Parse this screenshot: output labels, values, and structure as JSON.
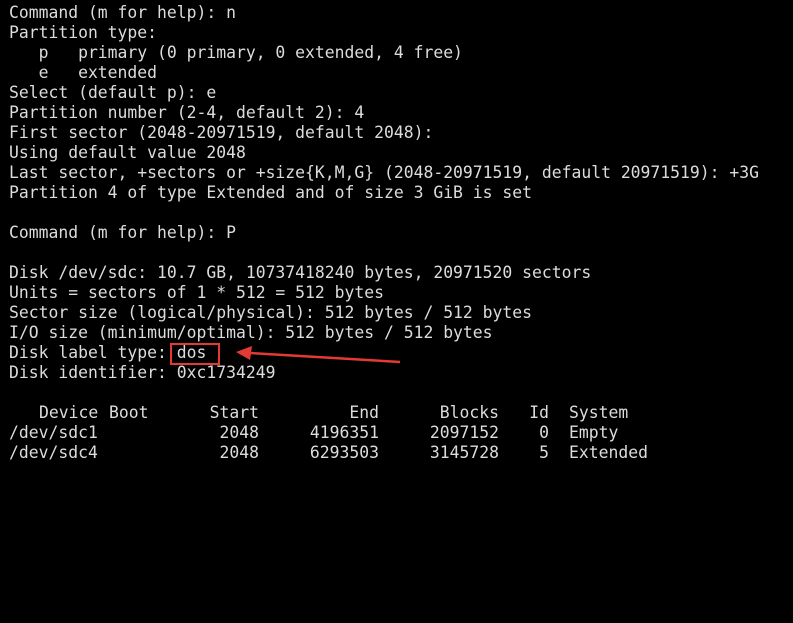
{
  "terminal": {
    "lines": [
      "Command (m for help): n",
      "Partition type:",
      "   p   primary (0 primary, 0 extended, 4 free)",
      "   e   extended",
      "Select (default p): e",
      "Partition number (2-4, default 2): 4",
      "First sector (2048-20971519, default 2048):",
      "Using default value 2048",
      "Last sector, +sectors or +size{K,M,G} (2048-20971519, default 20971519): +3G",
      "Partition 4 of type Extended and of size 3 GiB is set",
      "",
      "Command (m for help): P",
      "",
      "Disk /dev/sdc: 10.7 GB, 10737418240 bytes, 20971520 sectors",
      "Units = sectors of 1 * 512 = 512 bytes",
      "Sector size (logical/physical): 512 bytes / 512 bytes",
      "I/O size (minimum/optimal): 512 bytes / 512 bytes"
    ],
    "disk_label_prefix": "Disk label type: ",
    "disk_label_value": "dos",
    "disk_identifier": "Disk identifier: 0xc1734249",
    "table": {
      "headers": {
        "device": "Device",
        "boot": "Boot",
        "start": "Start",
        "end": "End",
        "blocks": "Blocks",
        "id": "Id",
        "system": "System"
      },
      "rows": [
        {
          "device": "/dev/sdc1",
          "boot": "",
          "start": "2048",
          "end": "4196351",
          "blocks": "2097152",
          "id": "0",
          "system": "Empty"
        },
        {
          "device": "/dev/sdc4",
          "boot": "",
          "start": "2048",
          "end": "6293503",
          "blocks": "3145728",
          "id": "5",
          "system": "Extended"
        }
      ]
    }
  },
  "annotation": {
    "color": "#e53935"
  }
}
